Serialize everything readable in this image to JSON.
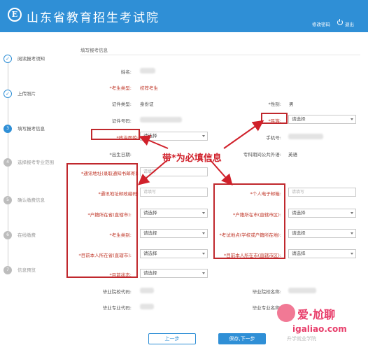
{
  "header": {
    "logo_letter": "E",
    "title": "山东省教育招生考试院",
    "change_password": "修改密码",
    "exit": "退出"
  },
  "steps": [
    {
      "label": "阅读报考须知",
      "icon": "✓"
    },
    {
      "label": "上传照片",
      "icon": "✓"
    },
    {
      "label": "填写报考信息",
      "icon": "3"
    },
    {
      "label": "选择报考专业范围",
      "icon": "4"
    },
    {
      "label": "确认缴费信息",
      "icon": "5"
    },
    {
      "label": "在线缴费",
      "icon": "6"
    },
    {
      "label": "信息预览",
      "icon": "7"
    }
  ],
  "form": {
    "section_title": "填写报考信息",
    "name_label": "姓名:",
    "exam_type_label": "*考生类型:",
    "exam_type_value": "校荐考生",
    "id_type_label": "证件类型:",
    "id_type_value": "身份证",
    "gender_label": "*性别:",
    "gender_value": "男",
    "id_number_label": "证件号码:",
    "nation_label": "*民族:",
    "political_label": "*政治面貌:",
    "phone_label": "手机号:",
    "birth_label": "*出生日期:",
    "language_label": "专科期间公共外语:",
    "language_value": "英语",
    "mail_addr_label": "*通讯地址(录取通知书邮寄):",
    "postal_label": "*通讯地址邮政编码:",
    "email_label": "*个人电子邮箱:",
    "hukou_prov_label": "*户籍所在省(直辖市):",
    "hukou_city_label": "*户籍所在市(直辖市区):",
    "category_label": "*考生类别:",
    "exam_site_label": "*考试地点(学校或户籍所在地):",
    "cur_prov_label": "*目前本人所在省(直辖市):",
    "cur_city_label": "*目前本人所在市(直辖市区):",
    "status_label": "*目前状态:",
    "grad_school_code_label": "毕业院校代码:",
    "grad_school_name_label": "毕业院校名称:",
    "grad_major_code_label": "毕业专业代码:",
    "grad_major_name_label": "毕业专业名称:",
    "select_placeholder": "请选择",
    "input_placeholder": "请填写"
  },
  "annotation": "带*为必填信息",
  "buttons": {
    "prev": "上一步",
    "next": "保存,下一步"
  },
  "watermark": {
    "brand": "爱·尬聊",
    "url": "igaliao.com",
    "sub": "升学就业学院"
  },
  "colors": {
    "header_bg": "#2f8fd6",
    "required": "#c0392b",
    "highlight": "#c0282d",
    "watermark": "#e83e6b"
  }
}
